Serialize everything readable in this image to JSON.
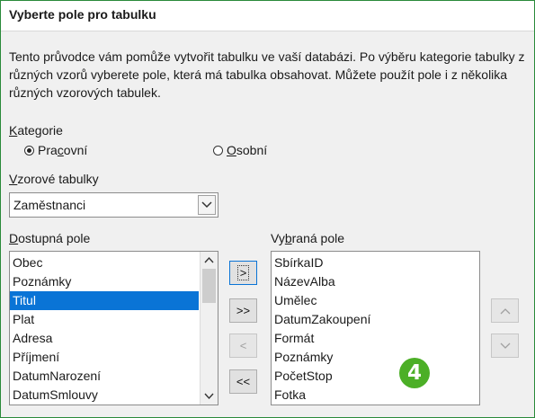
{
  "header": {
    "title": "Vyberte pole pro tabulku"
  },
  "description": "Tento průvodce vám pomůže vytvořit tabulku ve vaší databázi. Po výběru kategorie tabulky z různých vzorů vyberete pole, která má tabulka obsahovat. Můžete použít pole i z několika různých vzorových tabulek.",
  "category": {
    "label": "Kategorie",
    "options": [
      {
        "label": "Pracovní",
        "selected": true
      },
      {
        "label": "Osobní",
        "selected": false
      }
    ]
  },
  "sample_tables": {
    "label": "Vzorové tabulky",
    "value": "Zaměstnanci"
  },
  "available_fields": {
    "label": "Dostupná pole",
    "items": [
      "Obec",
      "Poznámky",
      "Titul",
      "Plat",
      "Adresa",
      "Příjmení",
      "DatumNarození",
      "DatumSmlouvy"
    ],
    "selected_item": "Titul"
  },
  "selected_fields": {
    "label": "Vybraná pole",
    "items": [
      "SbírkaID",
      "NázevAlba",
      "Umělec",
      "DatumZakoupení",
      "Formát",
      "Poznámky",
      "PočetStop",
      "Fotka"
    ]
  },
  "buttons": {
    "add_one": ">",
    "add_all": ">>",
    "remove_one": "<",
    "remove_all": "<<",
    "move_up": "^",
    "move_down": "v"
  },
  "badge": "4",
  "colors": {
    "selection": "#0a74d6",
    "badge": "#4caf27",
    "frame": "#2a8a3a"
  }
}
